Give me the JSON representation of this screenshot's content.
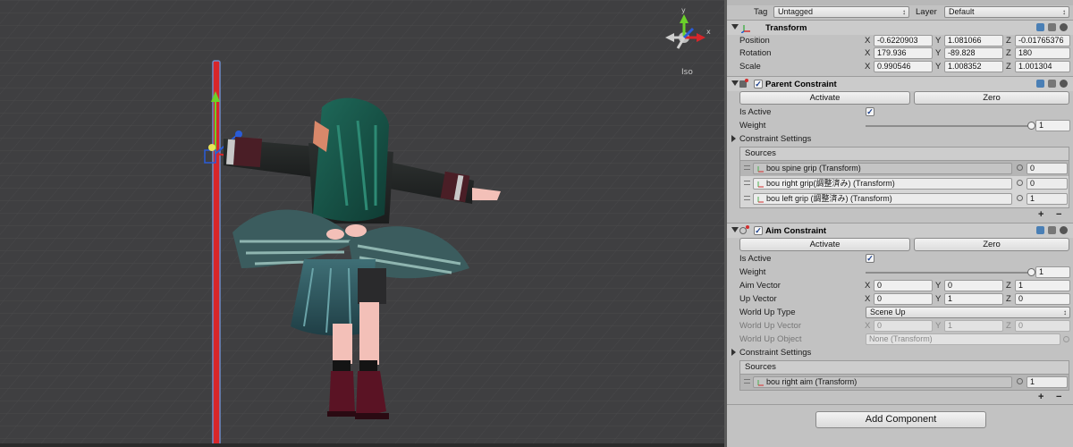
{
  "scene": {
    "projection_label": "Iso",
    "gizmo_axes": {
      "y": "y",
      "x": "x"
    }
  },
  "inspector": {
    "tag_label": "Tag",
    "tag_value": "Untagged",
    "layer_label": "Layer",
    "layer_value": "Default",
    "transform": {
      "title": "Transform",
      "rows": [
        {
          "label": "Position",
          "x": "-0.6220903",
          "y": "1.081066",
          "z": "-0.01765376"
        },
        {
          "label": "Rotation",
          "x": "179.936",
          "y": "-89.828",
          "z": "180"
        },
        {
          "label": "Scale",
          "x": "0.990546",
          "y": "1.008352",
          "z": "1.001304"
        }
      ]
    },
    "parent_constraint": {
      "title": "Parent Constraint",
      "activate_label": "Activate",
      "zero_label": "Zero",
      "is_active_label": "Is Active",
      "weight_label": "Weight",
      "weight_value": "1",
      "weight_fraction": 1.0,
      "constraint_settings_label": "Constraint Settings",
      "sources_label": "Sources",
      "sources": [
        {
          "name": "bou spine grip (Transform)",
          "weight": "0"
        },
        {
          "name": "bou right grip(調整済み) (Transform)",
          "weight": "0"
        },
        {
          "name": "bou left grip (調整済み) (Transform)",
          "weight": "1"
        }
      ]
    },
    "aim_constraint": {
      "title": "Aim Constraint",
      "activate_label": "Activate",
      "zero_label": "Zero",
      "is_active_label": "Is Active",
      "weight_label": "Weight",
      "weight_value": "1",
      "weight_fraction": 1.0,
      "aim_vector_label": "Aim Vector",
      "aim_vector": {
        "x": "0",
        "y": "0",
        "z": "1"
      },
      "up_vector_label": "Up Vector",
      "up_vector": {
        "x": "0",
        "y": "1",
        "z": "0"
      },
      "world_up_type_label": "World Up Type",
      "world_up_type_value": "Scene Up",
      "world_up_vector_label": "World Up Vector",
      "world_up_vector": {
        "x": "0",
        "y": "1",
        "z": "0"
      },
      "world_up_object_label": "World Up Object",
      "world_up_object_value": "None (Transform)",
      "constraint_settings_label": "Constraint Settings",
      "sources_label": "Sources",
      "sources": [
        {
          "name": "bou right aim (Transform)",
          "weight": "1"
        }
      ]
    },
    "add_component_label": "Add Component",
    "axis_labels": {
      "x": "X",
      "y": "Y",
      "z": "Z"
    },
    "plus": "+",
    "minus": "−"
  },
  "colors": {
    "scene_bg": "#3f3f41",
    "inspector_bg": "#c2c2c2",
    "axis_red": "#d8262a",
    "axis_green": "#6bd12a",
    "axis_blue": "#2a5cd8"
  }
}
